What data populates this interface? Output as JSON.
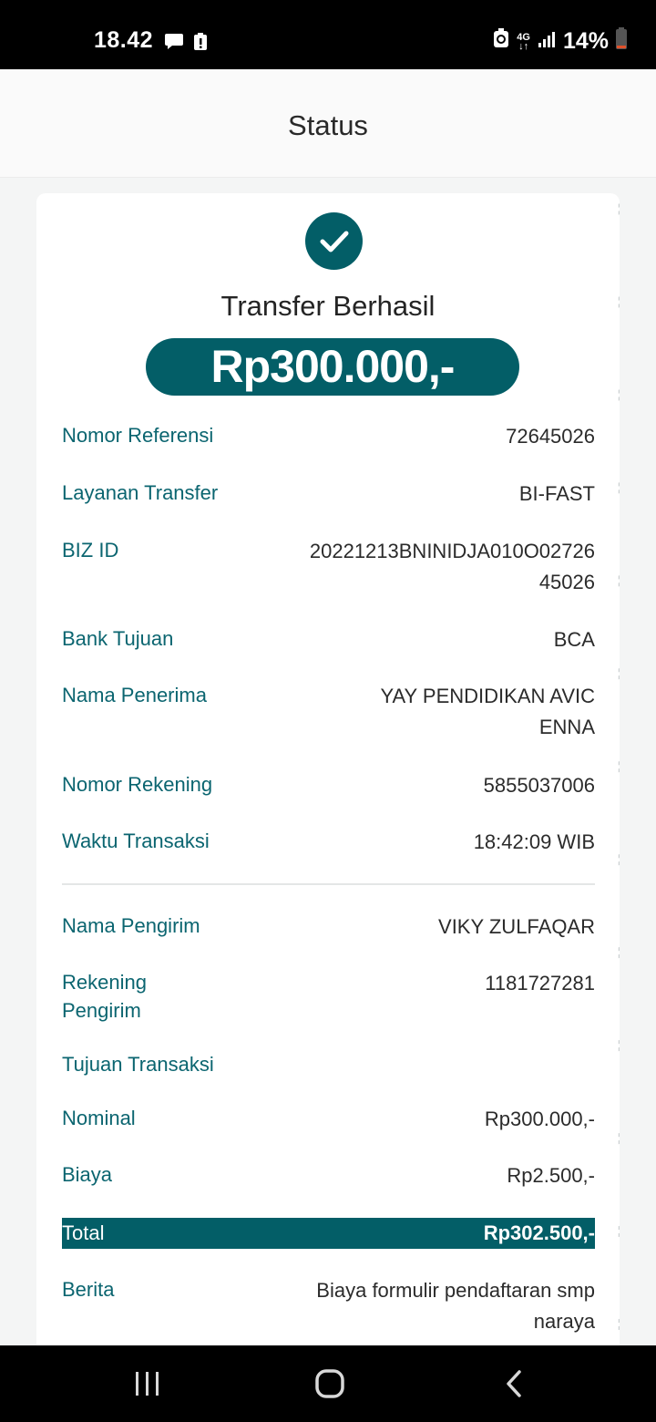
{
  "status_bar": {
    "time": "18.42",
    "network": "4G",
    "battery": "14%",
    "icons": [
      "message-icon",
      "alert-icon",
      "recycle-icon",
      "signal-icon",
      "battery-icon"
    ]
  },
  "header": {
    "title": "Status"
  },
  "result": {
    "icon": "check-icon",
    "title": "Transfer Berhasil",
    "amount": "Rp300.000,-"
  },
  "details": [
    {
      "label": "Nomor Referensi",
      "value": "72645026"
    },
    {
      "label": "Layanan Transfer",
      "value": "BI-FAST"
    },
    {
      "label": "BIZ ID",
      "value": "20221213BNINIDJA010O0272645026"
    },
    {
      "label": "Bank Tujuan",
      "value": "BCA"
    },
    {
      "label": "Nama Penerima",
      "value": "YAY PENDIDIKAN AVICENNA"
    },
    {
      "label": "Nomor Rekening",
      "value": "5855037006"
    },
    {
      "label": "Waktu Transaksi",
      "value": "18:42:09 WIB"
    }
  ],
  "sender": [
    {
      "label": "Nama Pengirim",
      "value": "VIKY ZULFAQAR"
    },
    {
      "label": "Rekening Pengirim",
      "value": "1181727281"
    },
    {
      "label": "Tujuan Transaksi",
      "value": ""
    },
    {
      "label": "Nominal",
      "value": "Rp300.000,-"
    },
    {
      "label": "Biaya",
      "value": "Rp2.500,-"
    }
  ],
  "total": {
    "label": "Total",
    "value": "Rp302.500,-"
  },
  "berita": {
    "label": "Berita",
    "value": "Biaya formulir pendaftaran smp naraya"
  },
  "watermark": "BNI",
  "colors": {
    "primary": "#035e67",
    "label": "#0b6570"
  },
  "navbar": {
    "icons": [
      "recent-apps-icon",
      "home-icon",
      "back-icon"
    ]
  }
}
